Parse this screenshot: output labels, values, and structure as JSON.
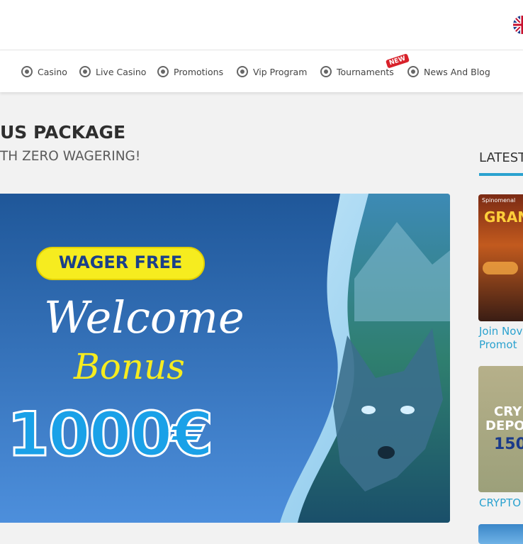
{
  "header": {
    "language_flag": "uk-flag-icon"
  },
  "nav": {
    "items": [
      {
        "label": "Casino",
        "icon": "casino-chip-icon"
      },
      {
        "label": "Live Casino",
        "icon": "live-casino-icon"
      },
      {
        "label": "Promotions",
        "icon": "gift-icon"
      },
      {
        "label": "Vip Program",
        "icon": "crown-icon"
      },
      {
        "label": "Tournaments",
        "icon": "trophy-icon"
      },
      {
        "label": "News And Blog",
        "icon": "megaphone-icon"
      }
    ],
    "new_badge": "NEW"
  },
  "main": {
    "title": "US PACKAGE",
    "subtitle": "TH ZERO WAGERING!",
    "banner": {
      "badge": "WAGER FREE",
      "line1": "Welcome",
      "line2": "Bonus",
      "amount": "1000€"
    },
    "bottom_text": ""
  },
  "sidebar": {
    "heading": "LATEST",
    "cards": [
      {
        "image_text": "GRAN",
        "image_small": "Spinomenal",
        "title_line1": "Join Nov",
        "title_line2": "Promot"
      },
      {
        "image_text_1": "CRY",
        "image_text_2": "DEPO",
        "image_text_3": "150",
        "title_line1": "CRYPTO",
        "title_line2": ""
      }
    ]
  },
  "colors": {
    "accent": "#2ba2cf",
    "banner_blue": "#2a6fc0",
    "badge_yellow": "#f6ec1f",
    "new_red": "#d8212a"
  }
}
